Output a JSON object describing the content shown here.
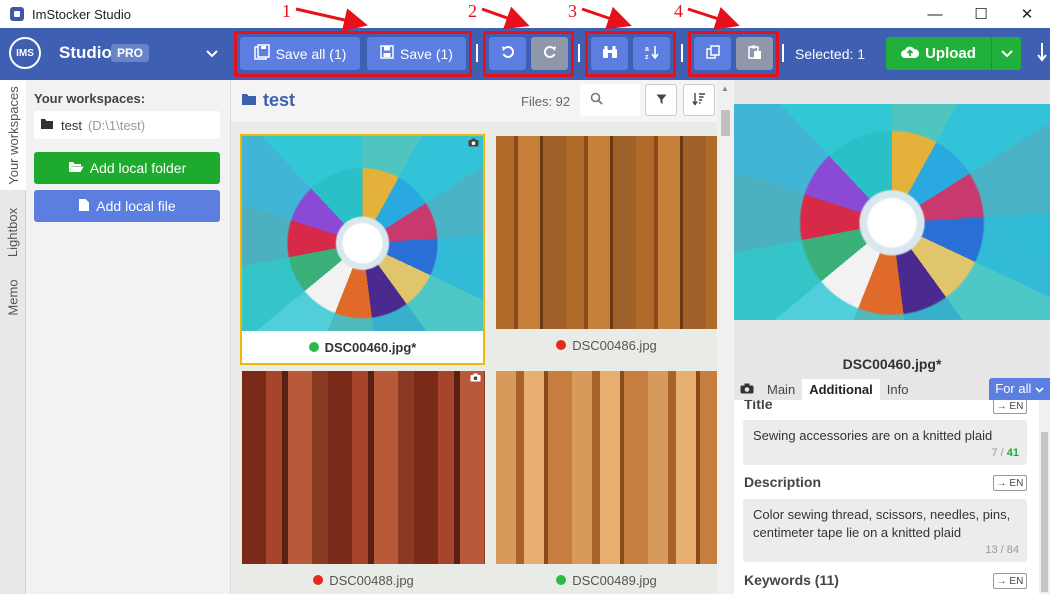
{
  "window": {
    "title": "ImStocker Studio",
    "minimize": "—",
    "maximize": "☐",
    "close": "✕"
  },
  "toolbar": {
    "logo": "IMS",
    "studio": "Studio",
    "pro": "PRO",
    "save_all": "Save all (1)",
    "save": "Save (1)",
    "selected": "Selected: 1",
    "upload": "Upload"
  },
  "annotations": [
    "1",
    "2",
    "3",
    "4"
  ],
  "vtabs": [
    "Your workspaces",
    "Lightbox",
    "Memo"
  ],
  "workspaces": {
    "title": "Your workspaces:",
    "item_name": "test",
    "item_path": "(D:\\1\\test)",
    "add_folder": "Add local folder",
    "add_file": "Add local file"
  },
  "gallery": {
    "folder": "test",
    "files": "Files: 92",
    "cards": [
      {
        "name": "DSC00460.jpg*",
        "status": "#2fb84a"
      },
      {
        "name": "DSC00486.jpg",
        "status": "#e62a1a"
      },
      {
        "name": "DSC00488.jpg",
        "status": "#e62a1a"
      },
      {
        "name": "DSC00489.jpg",
        "status": "#2fb84a"
      }
    ]
  },
  "details": {
    "filename": "DSC00460.jpg*",
    "tabs": [
      "Main",
      "Additional",
      "Info"
    ],
    "forall": "For all",
    "lang": "→ EN",
    "title_label": "Title",
    "title_value": "Sewing accessories are on a knitted plaid",
    "title_count": "7 / ",
    "title_max": "41",
    "desc_label": "Description",
    "desc_value": "Color sewing thread, scissors, needles, pins, centimeter tape lie on a knitted plaid",
    "desc_count": "13 / 84",
    "keywords_label": "Keywords (11)"
  },
  "colors": {
    "accent": "#3e5fb2",
    "button": "#5c7ee0",
    "green": "#1eaa2c",
    "annotation": "#e8101a",
    "selected_border": "#f2b705"
  }
}
